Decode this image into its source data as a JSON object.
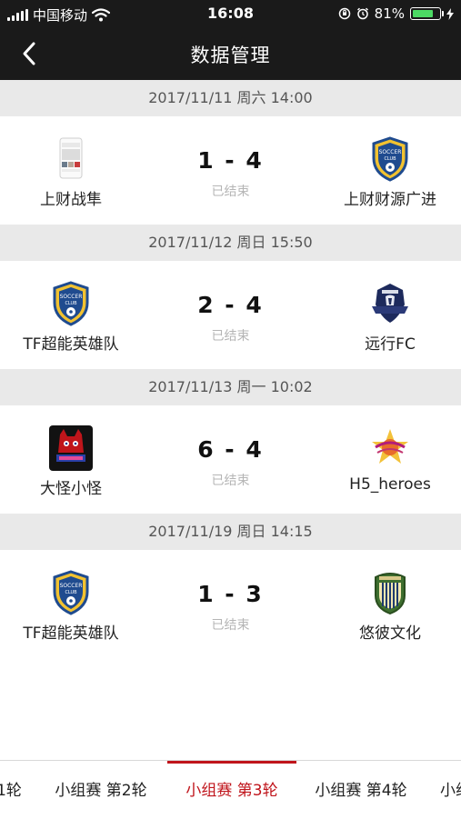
{
  "status_bar": {
    "carrier": "中国移动",
    "time": "16:08",
    "battery": "81%",
    "battery_level": 0.81
  },
  "header": {
    "title": "数据管理"
  },
  "matches": [
    {
      "date": "2017/11/11 周六 14:00",
      "home": "上财战隼",
      "away": "上财财源广进",
      "score": "1 - 4",
      "status": "已结束"
    },
    {
      "date": "2017/11/12 周日 15:50",
      "home": "TF超能英雄队",
      "away": "远行FC",
      "score": "2 - 4",
      "status": "已结束"
    },
    {
      "date": "2017/11/13 周一 10:02",
      "home": "大怪小怪",
      "away": "H5_heroes",
      "score": "6 - 4",
      "status": "已结束"
    },
    {
      "date": "2017/11/19 周日 14:15",
      "home": "TF超能英雄队",
      "away": "悠彼文化",
      "score": "1 - 3",
      "status": "已结束"
    }
  ],
  "logo_text": {
    "soccer": "SOCCER",
    "club": "CLUB"
  },
  "rounds": {
    "items": [
      "1轮",
      "小组赛 第2轮",
      "小组赛 第3轮",
      "小组赛 第4轮",
      "小组"
    ],
    "active_index": 2
  }
}
